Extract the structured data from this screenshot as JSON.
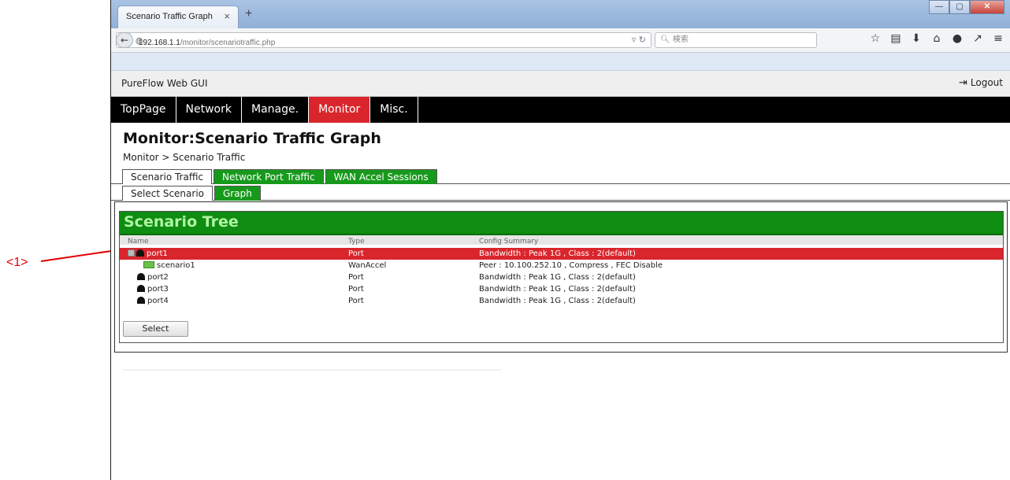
{
  "annotation": {
    "label": "<1>",
    "color": "#e00000"
  },
  "browser": {
    "tab_title": "Scenario Traffic Graph",
    "tab_close": "×",
    "new_tab": "+",
    "url_host": "192.168.1.1",
    "url_path": "/monitor/scenariotraffic.php",
    "search_placeholder": "検索",
    "window_controls": [
      "minimize-icon",
      "maximize-icon",
      "close-icon"
    ],
    "toolbar_icons": [
      "star-icon",
      "bookmarks-icon",
      "download-icon",
      "home-icon",
      "chat-icon",
      "share-icon",
      "menu-icon"
    ]
  },
  "app": {
    "title": "PureFlow Web GUI",
    "logout_label": "Logout",
    "menu": [
      {
        "label": "TopPage",
        "active": false
      },
      {
        "label": "Network",
        "active": false
      },
      {
        "label": "Manage.",
        "active": false
      },
      {
        "label": "Monitor",
        "active": true
      },
      {
        "label": "Misc.",
        "active": false
      }
    ],
    "page_title": "Monitor:Scenario Traffic Graph",
    "breadcrumb": "Monitor > Scenario Traffic",
    "tabs_primary": [
      {
        "label": "Scenario Traffic",
        "selected": true
      },
      {
        "label": "Network Port Traffic",
        "selected": false
      },
      {
        "label": "WAN Accel Sessions",
        "selected": false
      }
    ],
    "tabs_secondary": [
      {
        "label": "Select Scenario",
        "selected": true
      },
      {
        "label": "Graph",
        "selected": false
      }
    ]
  },
  "tree": {
    "title": "Scenario Tree",
    "columns": {
      "name": "Name",
      "type": "Type",
      "summary": "Config Summary"
    },
    "rows": [
      {
        "name": "port1",
        "type": "Port",
        "summary": "Bandwidth : Peak 1G , Class : 2(default)",
        "icon": "port-icon",
        "expanded": true,
        "selected": true
      },
      {
        "name": "scenario1",
        "type": "WanAccel",
        "summary": "Peer : 10.100.252.10 , Compress , FEC Disable",
        "icon": "scenario-icon",
        "child": true
      },
      {
        "name": "port2",
        "type": "Port",
        "summary": "Bandwidth : Peak 1G , Class : 2(default)",
        "icon": "port-icon"
      },
      {
        "name": "port3",
        "type": "Port",
        "summary": "Bandwidth : Peak 1G , Class : 2(default)",
        "icon": "port-icon"
      },
      {
        "name": "port4",
        "type": "Port",
        "summary": "Bandwidth : Peak 1G , Class : 2(default)",
        "icon": "port-icon"
      }
    ],
    "select_button": "Select"
  },
  "colors": {
    "accent_red": "#d9262c",
    "tab_green": "#179a1c",
    "tree_green": "#0f8c12",
    "menu_bg": "#000000"
  }
}
